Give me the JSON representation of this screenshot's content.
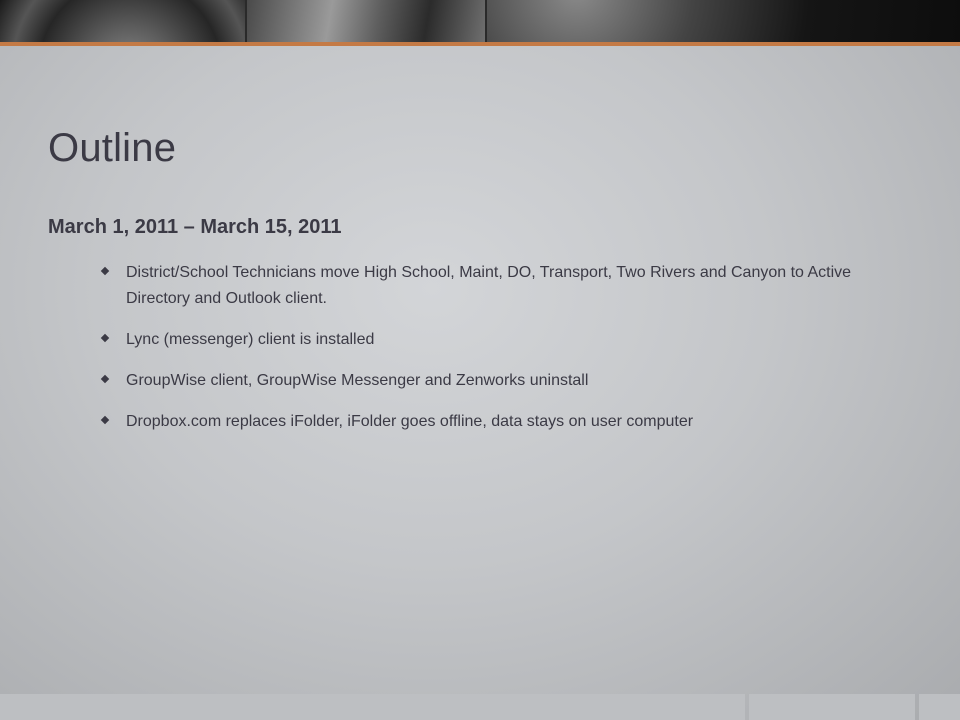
{
  "slide": {
    "title": "Outline",
    "subtitle": "March 1, 2011 – March 15, 2011",
    "bullets": [
      "District/School Technicians move High School, Maint, DO, Transport, Two Rivers and Canyon to Active Directory and Outlook client.",
      "Lync (messenger) client is installed",
      "GroupWise client, GroupWise Messenger and Zenworks uninstall",
      "Dropbox.com replaces iFolder, iFolder goes offline, data stays on user computer"
    ]
  },
  "colors": {
    "accent": "#c47a45",
    "text": "#3b3a45",
    "background": "#c4c6c9"
  }
}
